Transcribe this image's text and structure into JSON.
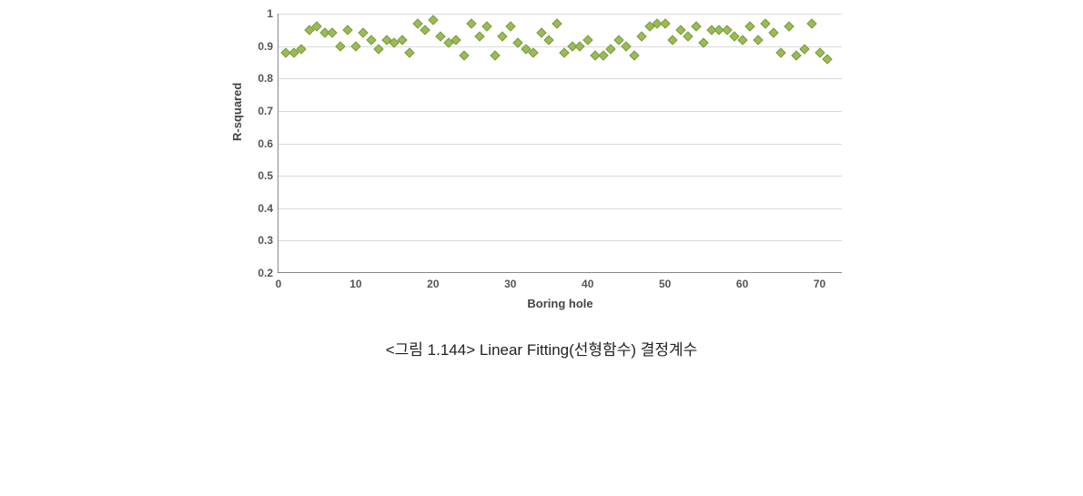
{
  "caption": "<그림 1.144> Linear Fitting(선형함수) 결정계수",
  "chart_data": {
    "type": "scatter",
    "xlabel": "Boring hole",
    "ylabel": "R-squared",
    "xlim": [
      0,
      73
    ],
    "ylim": [
      0.2,
      1.0
    ],
    "xticks": [
      0,
      10,
      20,
      30,
      40,
      50,
      60,
      70
    ],
    "yticks": [
      0.2,
      0.3,
      0.4,
      0.5,
      0.6,
      0.7,
      0.8,
      0.9,
      1.0
    ],
    "grid": "y",
    "series": [
      {
        "name": "R-squared",
        "color": "#9bbb59",
        "x": [
          1,
          2,
          3,
          4,
          5,
          6,
          7,
          8,
          9,
          10,
          11,
          12,
          13,
          14,
          15,
          16,
          17,
          18,
          19,
          20,
          21,
          22,
          23,
          24,
          25,
          26,
          27,
          28,
          29,
          30,
          31,
          32,
          33,
          34,
          35,
          36,
          37,
          38,
          39,
          40,
          41,
          42,
          43,
          44,
          45,
          46,
          47,
          48,
          49,
          50,
          51,
          52,
          53,
          54,
          55,
          56,
          57,
          58,
          59,
          60,
          61,
          62,
          63,
          64,
          65,
          66,
          67,
          68,
          69,
          70,
          71
        ],
        "y": [
          0.88,
          0.88,
          0.89,
          0.95,
          0.96,
          0.94,
          0.94,
          0.9,
          0.95,
          0.9,
          0.94,
          0.92,
          0.89,
          0.92,
          0.91,
          0.92,
          0.88,
          0.97,
          0.95,
          0.98,
          0.93,
          0.91,
          0.92,
          0.87,
          0.97,
          0.93,
          0.96,
          0.87,
          0.93,
          0.96,
          0.91,
          0.89,
          0.88,
          0.94,
          0.92,
          0.97,
          0.88,
          0.9,
          0.9,
          0.92,
          0.87,
          0.87,
          0.89,
          0.92,
          0.9,
          0.87,
          0.93,
          0.96,
          0.97,
          0.97,
          0.92,
          0.95,
          0.93,
          0.96,
          0.91,
          0.95,
          0.95,
          0.95,
          0.93,
          0.92,
          0.96,
          0.92,
          0.97,
          0.94,
          0.88,
          0.96,
          0.87,
          0.89,
          0.97,
          0.88,
          0.86
        ]
      }
    ]
  }
}
